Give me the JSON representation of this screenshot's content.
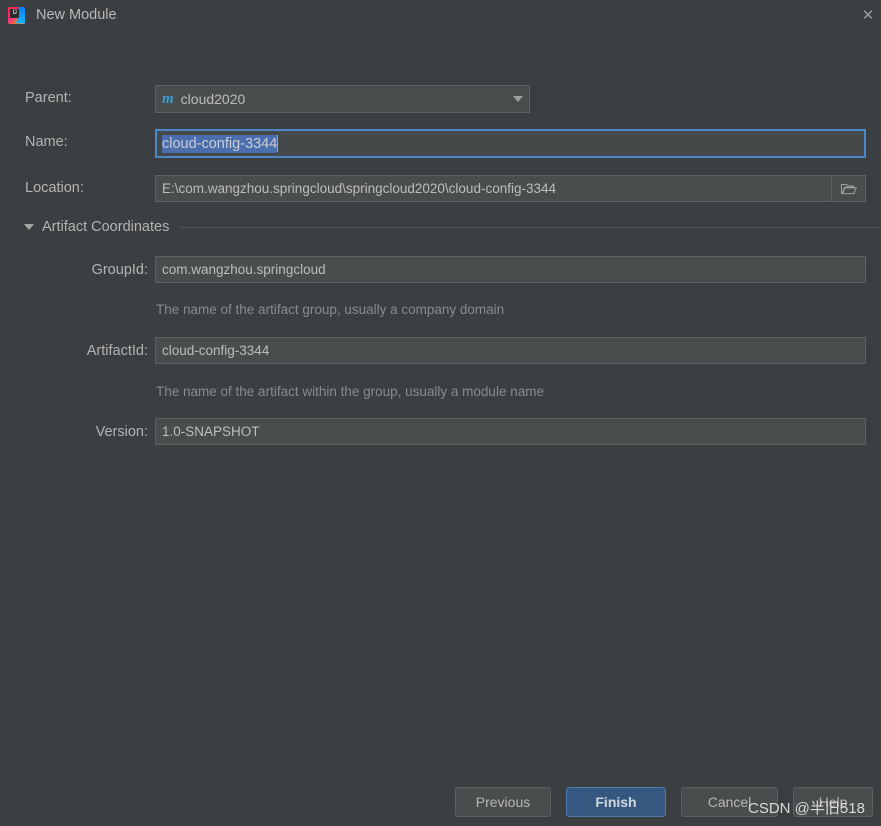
{
  "window": {
    "title": "New Module",
    "app_icon": "intellij-idea-logo",
    "close_label": "✕"
  },
  "form": {
    "parent": {
      "label": "Parent:",
      "value": "cloud2020",
      "icon": "maven-module-icon",
      "icon_glyph": "m",
      "dropdown_icon": "chevron-down-icon"
    },
    "name": {
      "label": "Name:",
      "value": "cloud-config-3344",
      "placeholder": "",
      "selected": true
    },
    "location": {
      "label": "Location:",
      "value": "E:\\com.wangzhou.springcloud\\springcloud2020\\cloud-config-3344",
      "placeholder": "",
      "browse_icon": "folder-icon"
    }
  },
  "artifact_coordinates": {
    "section_label": "Artifact Coordinates",
    "expanded": true,
    "collapse_icon": "triangle-down-icon",
    "group_id": {
      "label": "GroupId:",
      "value": "com.wangzhou.springcloud",
      "hint": "The name of the artifact group, usually a company domain"
    },
    "artifact_id": {
      "label": "ArtifactId:",
      "value": "cloud-config-3344",
      "hint": "The name of the artifact within the group, usually a module name"
    },
    "version": {
      "label": "Version:",
      "value": "1.0-SNAPSHOT"
    }
  },
  "footer": {
    "previous_label": "Previous",
    "finish_label": "Finish",
    "cancel_label": "Cancel",
    "help_label": "Help"
  },
  "watermark": {
    "text": "CSDN @半旧518"
  },
  "colors": {
    "dialog_background": "#3c3f41",
    "field_background": "#4a4d4e",
    "field_border": "#5e6060",
    "focus_border": "#4a88c7",
    "selection": "#4b6eaf",
    "primary_button": "#365880",
    "maven_icon": "#389fd6",
    "text": "#b4b4b4",
    "hint_text": "#888b8d"
  }
}
